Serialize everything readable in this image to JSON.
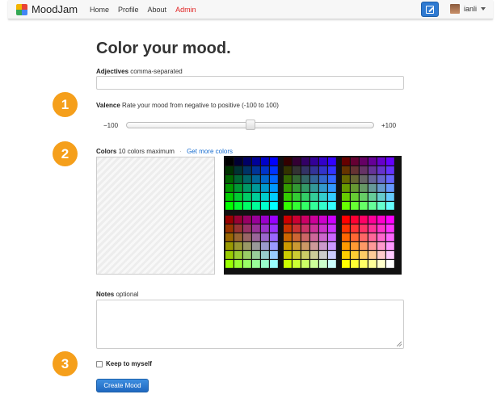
{
  "navbar": {
    "brand": "MoodJam",
    "links": [
      {
        "label": "Home",
        "active": false
      },
      {
        "label": "Profile",
        "active": false
      },
      {
        "label": "About",
        "active": false
      },
      {
        "label": "Admin",
        "active": true
      }
    ],
    "user": "ianli",
    "logo_colors": [
      "#f4b400",
      "#e94235",
      "#34a853",
      "#4285f4"
    ]
  },
  "page": {
    "title": "Color your mood."
  },
  "adjectives": {
    "label": "Adjectives",
    "hint": "comma-separated",
    "value": ""
  },
  "steps": [
    "1",
    "2",
    "3"
  ],
  "valence": {
    "label": "Valence",
    "hint": "Rate your mood from negative to positive (-100 to 100)",
    "min_label": "−100",
    "max_label": "+100",
    "value": 0,
    "min": -100,
    "max": 100
  },
  "colors": {
    "label": "Colors",
    "hint": "10 colors maximum",
    "separator": "·",
    "link": "Get more colors"
  },
  "notes": {
    "label": "Notes",
    "hint": "optional",
    "value": ""
  },
  "privacy": {
    "label": "Keep to myself",
    "checked": false
  },
  "submit": {
    "label": "Create Mood"
  },
  "icons": {
    "edit": "edit-icon",
    "caret": "caret-down-icon",
    "avatar": "avatar"
  }
}
